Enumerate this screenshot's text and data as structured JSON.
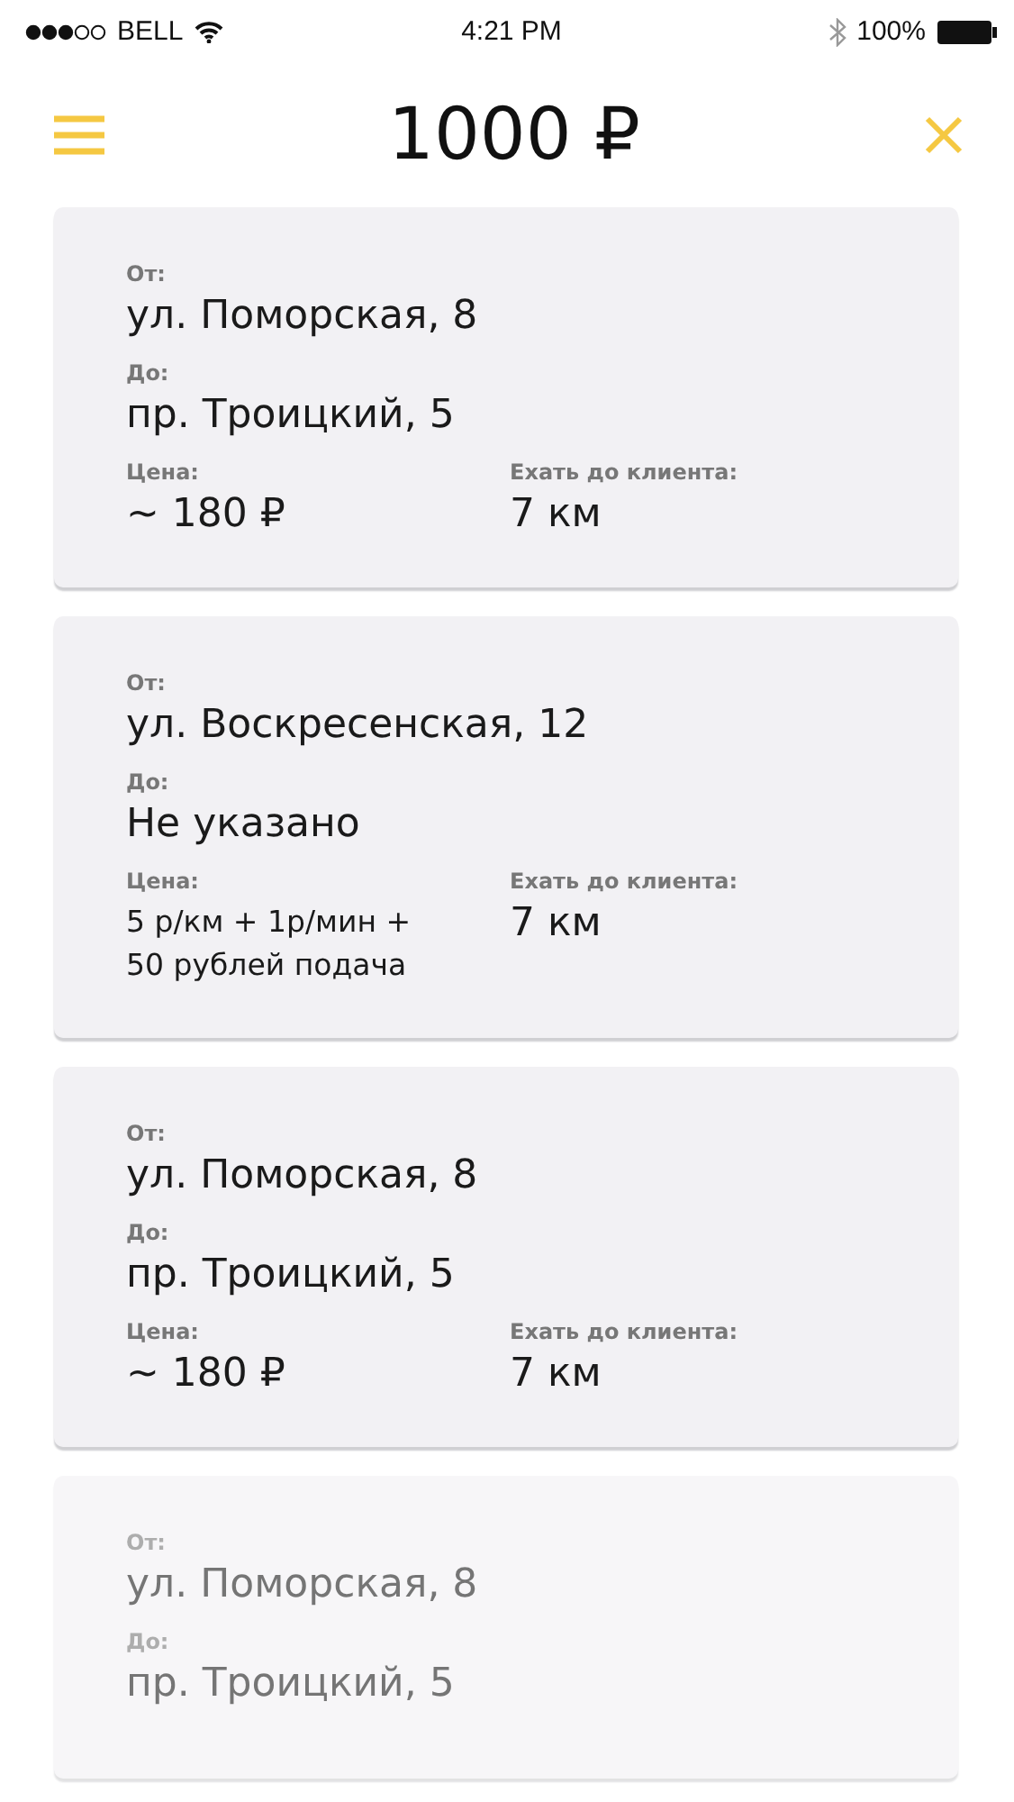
{
  "status_bar": {
    "carrier": "BELL",
    "time": "4:21 PM",
    "battery": "100%"
  },
  "header": {
    "title": "1000 ₽"
  },
  "orders": [
    {
      "faded": false,
      "from_label": "От:",
      "from": "ул. Поморская, 8",
      "to_label": "До:",
      "to": "пр. Троицкий, 5",
      "price_label": "Цена:",
      "price": "~ 180 ₽",
      "distance_label": "Ехать до клиента:",
      "distance": "7 км"
    },
    {
      "faded": false,
      "from_label": "От:",
      "from": "ул. Воскресенская, 12",
      "to_label": "До:",
      "to": "Не указано",
      "price_label": "Цена:",
      "price": "5 р/км + 1р/мин + 50 рублей подача",
      "distance_label": "Ехать до клиента:",
      "distance": "7 км"
    },
    {
      "faded": false,
      "from_label": "От:",
      "from": "ул. Поморская, 8",
      "to_label": "До:",
      "to": "пр. Троицкий, 5",
      "price_label": "Цена:",
      "price": "~ 180 ₽",
      "distance_label": "Ехать до клиента:",
      "distance": "7 км"
    },
    {
      "faded": true,
      "from_label": "От:",
      "from": "ул. Поморская, 8",
      "to_label": "До:",
      "to": "пр. Троицкий, 5"
    }
  ]
}
